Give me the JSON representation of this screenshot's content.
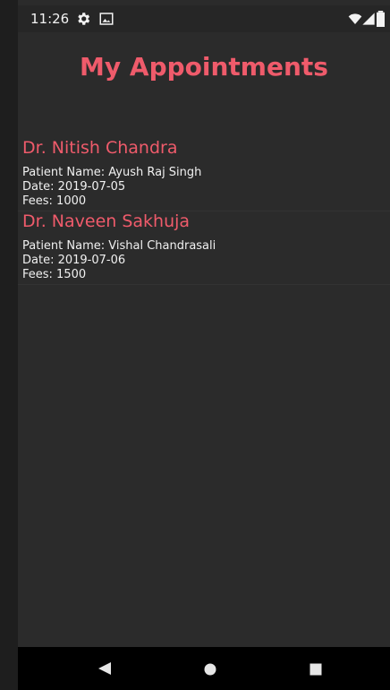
{
  "status_bar": {
    "time": "11:26",
    "icons": [
      "gear-icon",
      "gallery-icon",
      "wifi-icon",
      "signal-icon",
      "battery-icon"
    ]
  },
  "page": {
    "title": "My Appointments",
    "accent_color": "#ef5b6b"
  },
  "appointments": [
    {
      "doctor": "Dr. Nitish Chandra",
      "patient": "Patient Name: Ayush Raj Singh",
      "date": "Date: 2019-07-05",
      "fees": "Fees: 1000"
    },
    {
      "doctor": "Dr. Naveen Sakhuja",
      "patient": "Patient Name: Vishal Chandrasali",
      "date": "Date: 2019-07-06",
      "fees": "Fees: 1500"
    }
  ],
  "nav": {
    "icons": [
      "back-icon",
      "home-icon",
      "recents-icon"
    ]
  }
}
